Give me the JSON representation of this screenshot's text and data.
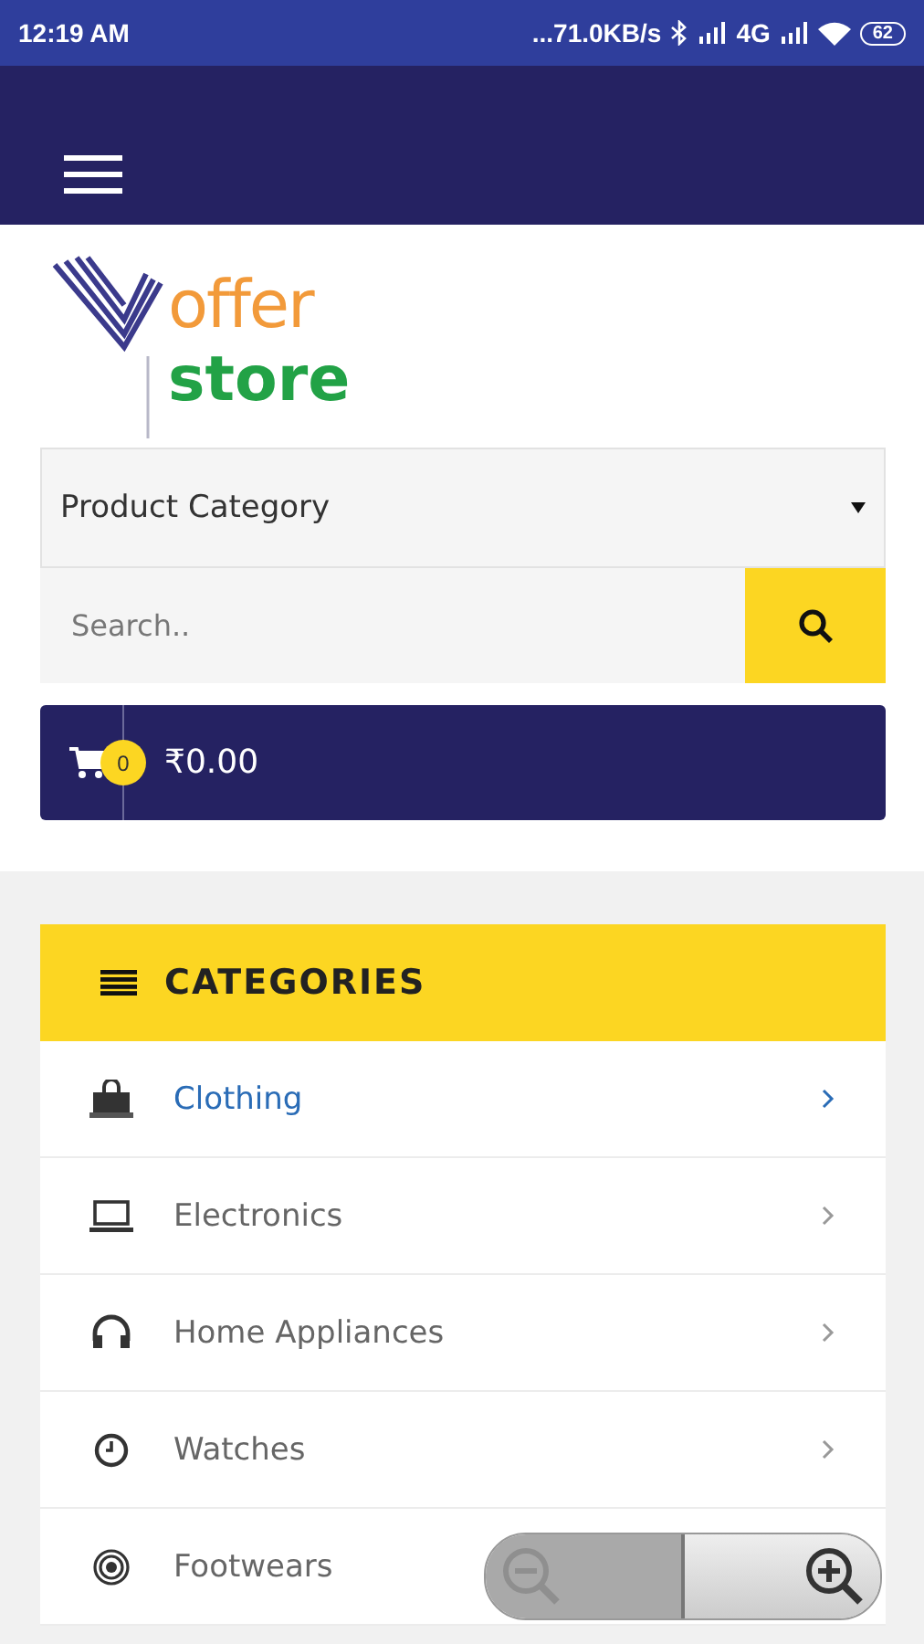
{
  "status_bar": {
    "time": "12:19 AM",
    "speed": "...71.0KB/s",
    "network": "4G",
    "battery": "62"
  },
  "logo": {
    "top": "offer",
    "bottom": "store"
  },
  "category_select": {
    "value": "Product Category"
  },
  "search": {
    "placeholder": "Search.."
  },
  "cart": {
    "count": "0",
    "total": "₹0.00"
  },
  "categories": {
    "title": "CATEGORIES",
    "items": [
      {
        "label": "Clothing",
        "kind": "bag",
        "selected": true
      },
      {
        "label": "Electronics",
        "kind": "laptop",
        "selected": false
      },
      {
        "label": "Home Appliances",
        "kind": "headphones",
        "selected": false
      },
      {
        "label": "Watches",
        "kind": "clock",
        "selected": false
      },
      {
        "label": "Footwears",
        "kind": "target",
        "selected": false
      }
    ]
  },
  "zoom_control": {
    "zoom_out_disabled": true,
    "zoom_in_disabled": false
  }
}
